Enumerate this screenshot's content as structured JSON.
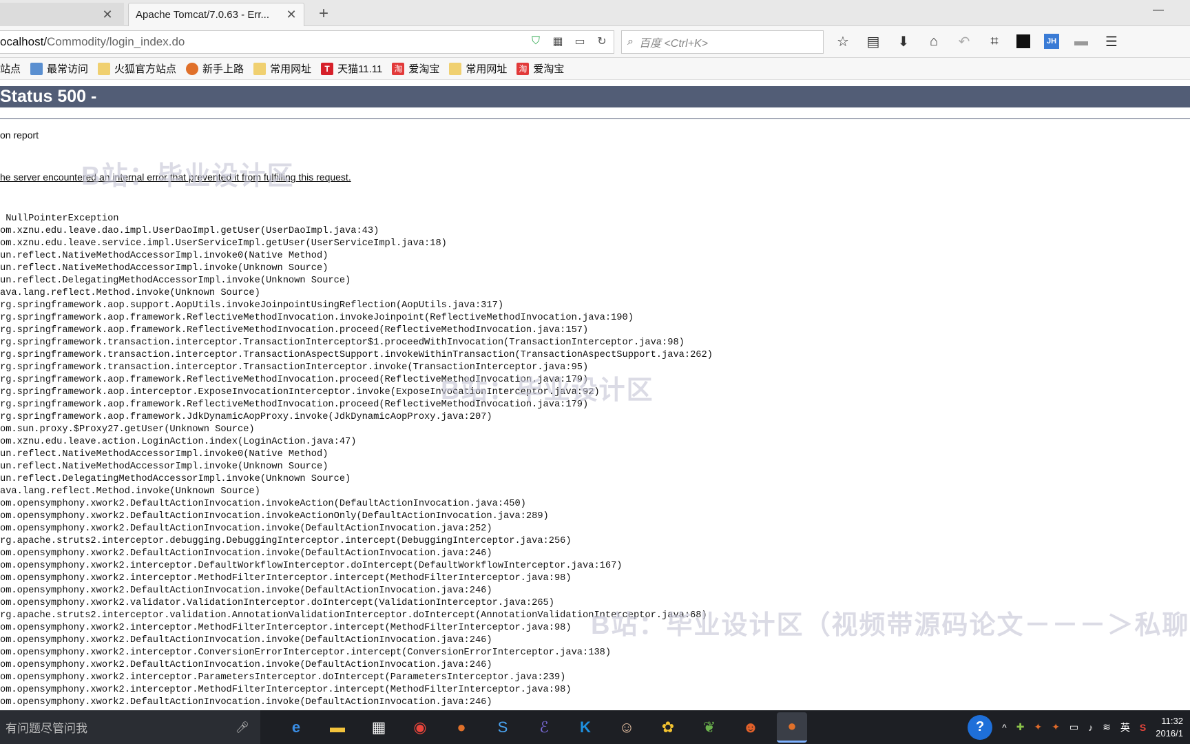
{
  "tabs": [
    {
      "label": ""
    },
    {
      "label": "Apache Tomcat/7.0.63 - Err..."
    }
  ],
  "url": {
    "host": "ocalhost/",
    "path": "Commodity/login_index.do"
  },
  "search": {
    "placeholder": "百度 <Ctrl+K>"
  },
  "bookmarks": [
    "站点",
    "最常访问",
    "火狐官方站点",
    "新手上路",
    "常用网址",
    "天猫11.11",
    "爱淘宝",
    "常用网址",
    "爱淘宝"
  ],
  "page": {
    "status_heading": "Status 500 -",
    "report_label": "on report",
    "description": "he server encountered an internal error that prevented it from fulfilling this request.",
    "trace": [
      " NullPointerException",
      "om.xznu.edu.leave.dao.impl.UserDaoImpl.getUser(UserDaoImpl.java:43)",
      "om.xznu.edu.leave.service.impl.UserServiceImpl.getUser(UserServiceImpl.java:18)",
      "un.reflect.NativeMethodAccessorImpl.invoke0(Native Method)",
      "un.reflect.NativeMethodAccessorImpl.invoke(Unknown Source)",
      "un.reflect.DelegatingMethodAccessorImpl.invoke(Unknown Source)",
      "ava.lang.reflect.Method.invoke(Unknown Source)",
      "rg.springframework.aop.support.AopUtils.invokeJoinpointUsingReflection(AopUtils.java:317)",
      "rg.springframework.aop.framework.ReflectiveMethodInvocation.invokeJoinpoint(ReflectiveMethodInvocation.java:190)",
      "rg.springframework.aop.framework.ReflectiveMethodInvocation.proceed(ReflectiveMethodInvocation.java:157)",
      "rg.springframework.transaction.interceptor.TransactionInterceptor$1.proceedWithInvocation(TransactionInterceptor.java:98)",
      "rg.springframework.transaction.interceptor.TransactionAspectSupport.invokeWithinTransaction(TransactionAspectSupport.java:262)",
      "rg.springframework.transaction.interceptor.TransactionInterceptor.invoke(TransactionInterceptor.java:95)",
      "rg.springframework.aop.framework.ReflectiveMethodInvocation.proceed(ReflectiveMethodInvocation.java:179)",
      "rg.springframework.aop.interceptor.ExposeInvocationInterceptor.invoke(ExposeInvocationInterceptor.java:92)",
      "rg.springframework.aop.framework.ReflectiveMethodInvocation.proceed(ReflectiveMethodInvocation.java:179)",
      "rg.springframework.aop.framework.JdkDynamicAopProxy.invoke(JdkDynamicAopProxy.java:207)",
      "om.sun.proxy.$Proxy27.getUser(Unknown Source)",
      "om.xznu.edu.leave.action.LoginAction.index(LoginAction.java:47)",
      "un.reflect.NativeMethodAccessorImpl.invoke0(Native Method)",
      "un.reflect.NativeMethodAccessorImpl.invoke(Unknown Source)",
      "un.reflect.DelegatingMethodAccessorImpl.invoke(Unknown Source)",
      "ava.lang.reflect.Method.invoke(Unknown Source)",
      "om.opensymphony.xwork2.DefaultActionInvocation.invokeAction(DefaultActionInvocation.java:450)",
      "om.opensymphony.xwork2.DefaultActionInvocation.invokeActionOnly(DefaultActionInvocation.java:289)",
      "om.opensymphony.xwork2.DefaultActionInvocation.invoke(DefaultActionInvocation.java:252)",
      "rg.apache.struts2.interceptor.debugging.DebuggingInterceptor.intercept(DebuggingInterceptor.java:256)",
      "om.opensymphony.xwork2.DefaultActionInvocation.invoke(DefaultActionInvocation.java:246)",
      "om.opensymphony.xwork2.interceptor.DefaultWorkflowInterceptor.doIntercept(DefaultWorkflowInterceptor.java:167)",
      "om.opensymphony.xwork2.interceptor.MethodFilterInterceptor.intercept(MethodFilterInterceptor.java:98)",
      "om.opensymphony.xwork2.DefaultActionInvocation.invoke(DefaultActionInvocation.java:246)",
      "om.opensymphony.xwork2.validator.ValidationInterceptor.doIntercept(ValidationInterceptor.java:265)",
      "rg.apache.struts2.interceptor.validation.AnnotationValidationInterceptor.doIntercept(AnnotationValidationInterceptor.java:68)",
      "om.opensymphony.xwork2.interceptor.MethodFilterInterceptor.intercept(MethodFilterInterceptor.java:98)",
      "om.opensymphony.xwork2.DefaultActionInvocation.invoke(DefaultActionInvocation.java:246)",
      "om.opensymphony.xwork2.interceptor.ConversionErrorInterceptor.intercept(ConversionErrorInterceptor.java:138)",
      "om.opensymphony.xwork2.DefaultActionInvocation.invoke(DefaultActionInvocation.java:246)",
      "om.opensymphony.xwork2.interceptor.ParametersInterceptor.doIntercept(ParametersInterceptor.java:239)",
      "om.opensymphony.xwork2.interceptor.MethodFilterInterceptor.intercept(MethodFilterInterceptor.java:98)",
      "om.opensymphony.xwork2.DefaultActionInvocation.invoke(DefaultActionInvocation.java:246)"
    ]
  },
  "watermarks": [
    "B站：毕业设计区",
    "B站：毕业设计区",
    "B站：毕业设计区（视频带源码论文－－－＞私聊）"
  ],
  "taskbar": {
    "search_placeholder": "有问题尽管问我",
    "ime": "英",
    "time": "11:32",
    "date": "2016/1"
  },
  "colors": {
    "status_bar": "#525d76",
    "taskbar": "#1d1f24"
  }
}
